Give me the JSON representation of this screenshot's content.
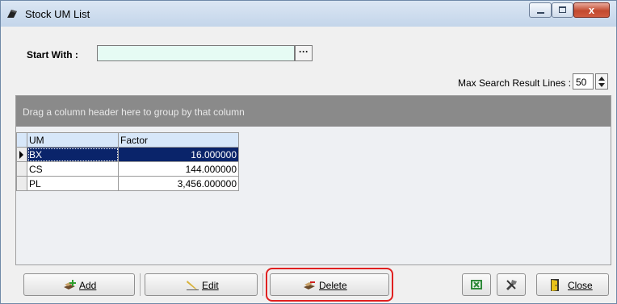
{
  "window": {
    "title": "Stock UM List",
    "controls": {
      "close_label": "x"
    }
  },
  "search": {
    "start_label": "Start With :",
    "start_value": "",
    "ellipsis_label": "···",
    "max_label": "Max Search Result Lines :",
    "max_value": "50"
  },
  "grid": {
    "group_hint": "Drag a column header here to group by that column",
    "columns": [
      "UM",
      "Factor"
    ],
    "rows": [
      {
        "um": "BX",
        "factor": "16.000000",
        "selected": true
      },
      {
        "um": "CS",
        "factor": "144.000000",
        "selected": false
      },
      {
        "um": "PL",
        "factor": "3,456.000000",
        "selected": false
      }
    ]
  },
  "toolbar": {
    "add_label": "Add",
    "edit_label": "Edit",
    "delete_label": "Delete",
    "close_label": "Close",
    "excel_icon": "excel-icon",
    "tools_icon": "tools-icon"
  },
  "colors": {
    "selection": "#0a246a",
    "input_bg": "#e6fbf4",
    "group_bar": "#8a8a8a",
    "highlight": "#e02020"
  }
}
